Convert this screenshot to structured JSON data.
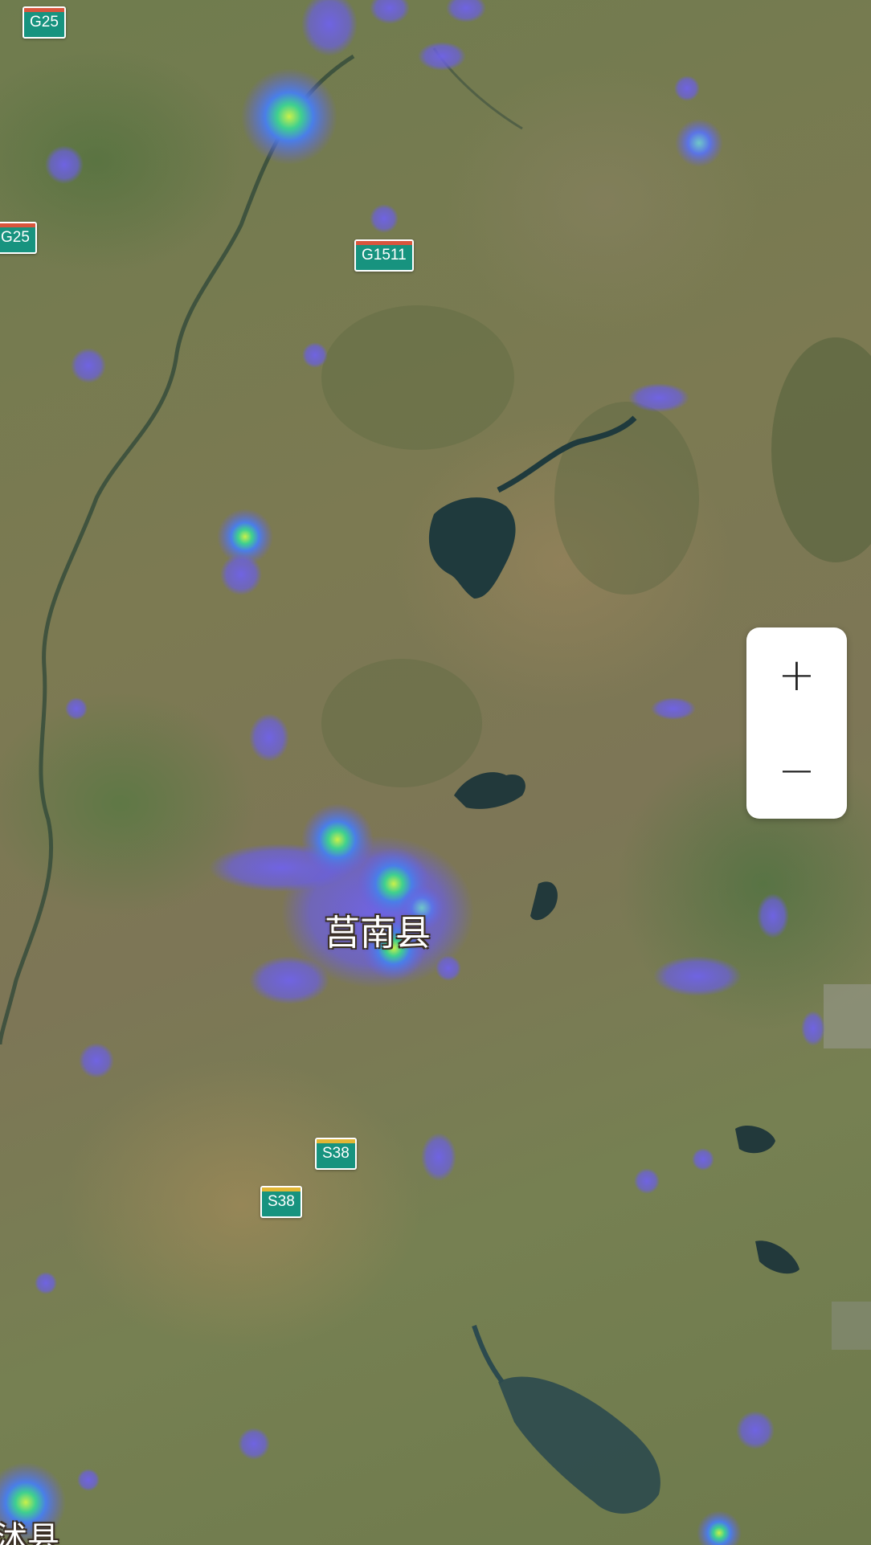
{
  "map": {
    "type": "satellite",
    "overlay": "heatmap",
    "heat_colors": [
      "#6a5fe0",
      "#4f7fe8",
      "#37c79a",
      "#9ee04a"
    ],
    "place_labels": {
      "county_main": "莒南县",
      "county_bottom_left": "沭县"
    },
    "road_shields": [
      {
        "code": "G25",
        "category": "national-expressway",
        "cap_color": "#d9553d"
      },
      {
        "code": "G25",
        "category": "national-expressway",
        "cap_color": "#d9553d"
      },
      {
        "code": "G1511",
        "category": "national-expressway",
        "cap_color": "#d9553d"
      },
      {
        "code": "S38",
        "category": "provincial-expressway",
        "cap_color": "#e2b634"
      },
      {
        "code": "S38",
        "category": "provincial-expressway",
        "cap_color": "#e2b634"
      }
    ],
    "zoom_controls": {
      "zoom_in_label": "+",
      "zoom_out_label": "−",
      "zoom_in_icon": "plus-icon",
      "zoom_out_icon": "minus-icon"
    }
  }
}
